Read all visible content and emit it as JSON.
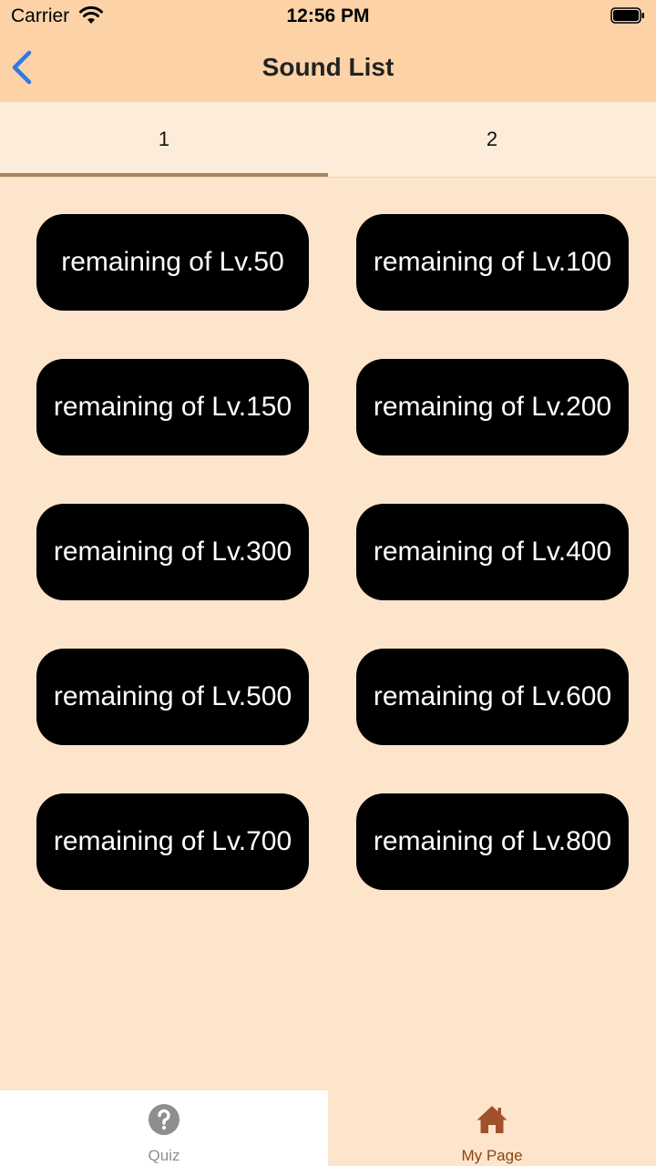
{
  "status_bar": {
    "carrier": "Carrier",
    "time": "12:56 PM"
  },
  "nav": {
    "title": "Sound List"
  },
  "tabs": [
    {
      "label": "1",
      "selected": true
    },
    {
      "label": "2",
      "selected": false
    }
  ],
  "buttons": [
    "remaining of Lv.50",
    "remaining of Lv.100",
    "remaining of Lv.150",
    "remaining of Lv.200",
    "remaining of Lv.300",
    "remaining of Lv.400",
    "remaining of Lv.500",
    "remaining of Lv.600",
    "remaining of Lv.700",
    "remaining of Lv.800"
  ],
  "tab_bar": {
    "items": [
      {
        "label": "Quiz",
        "icon": "question-circle-icon",
        "selected": false
      },
      {
        "label": "My Page",
        "icon": "home-icon",
        "selected": true
      }
    ]
  },
  "colors": {
    "header_bg": "#fdd2a7",
    "content_bg": "#fde5cc",
    "tab_indicator": "#a9845c",
    "back_blue": "#2f7ae5",
    "active_tab_brown": "#8b4513"
  }
}
